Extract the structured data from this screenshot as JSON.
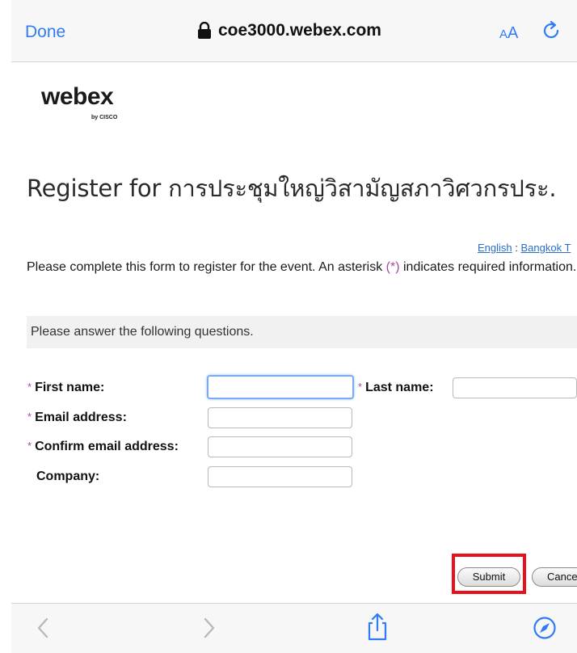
{
  "browser": {
    "done_label": "Done",
    "url": "coe3000.webex.com",
    "text_size_small": "A",
    "text_size_large": "A"
  },
  "logo": {
    "wordmark": "webex",
    "byline": "by CISCO"
  },
  "page": {
    "title": "Register for การประชุมใหญ่วิสามัญสภาวิศวกรประ.",
    "lang_english": "English",
    "lang_sep": " : ",
    "lang_timezone": "Bangkok T",
    "intro_before": "Please complete this form to register for the event. An asterisk ",
    "intro_marker": "(*)",
    "intro_after": " indicates required information.",
    "questions_header": "Please answer the following questions."
  },
  "form": {
    "required_mark": "*",
    "first_name_label": "First name:",
    "first_name_value": "",
    "last_name_label": "Last name:",
    "last_name_value": "",
    "email_label": "Email address:",
    "email_value": "",
    "confirm_email_label": "Confirm email address:",
    "confirm_email_value": "",
    "company_label": "Company:",
    "company_value": "",
    "submit_label": "Submit",
    "cancel_label": "Cancel"
  },
  "toolbar": {
    "icons": [
      "back-icon",
      "forward-icon",
      "share-icon",
      "compass-icon"
    ]
  },
  "colors": {
    "ios_blue": "#2f7cf6",
    "required_purple": "#a34ba3",
    "link_blue": "#2a6fc9",
    "highlight_red": "#e8101a"
  }
}
